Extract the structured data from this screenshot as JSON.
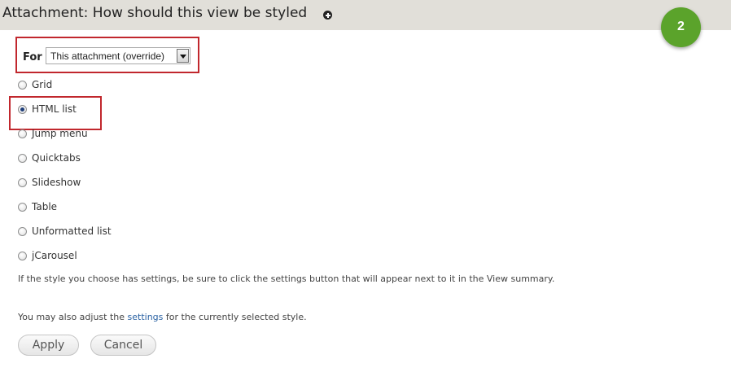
{
  "header": {
    "title": "Attachment: How should this view be styled",
    "icon": "plus-circle-icon",
    "background": "#e1dfd9"
  },
  "step_badge": {
    "label": "2",
    "color": "#5ba32b"
  },
  "for_field": {
    "label": "For",
    "selected": "This attachment (override)"
  },
  "styles": {
    "options": [
      {
        "label": "Grid",
        "checked": false
      },
      {
        "label": "HTML list",
        "checked": true
      },
      {
        "label": "Jump menu",
        "checked": false
      },
      {
        "label": "Quicktabs",
        "checked": false
      },
      {
        "label": "Slideshow",
        "checked": false
      },
      {
        "label": "Table",
        "checked": false
      },
      {
        "label": "Unformatted list",
        "checked": false
      },
      {
        "label": "jCarousel",
        "checked": false
      }
    ]
  },
  "help": {
    "settings_hint": "If the style you choose has settings, be sure to click the settings button that will appear next to it in the View summary.",
    "adjust_prefix": "You may also adjust the ",
    "adjust_link": "settings",
    "adjust_suffix": " for the currently selected style."
  },
  "buttons": {
    "apply": "Apply",
    "cancel": "Cancel"
  },
  "highlight_color": "#c1272d"
}
